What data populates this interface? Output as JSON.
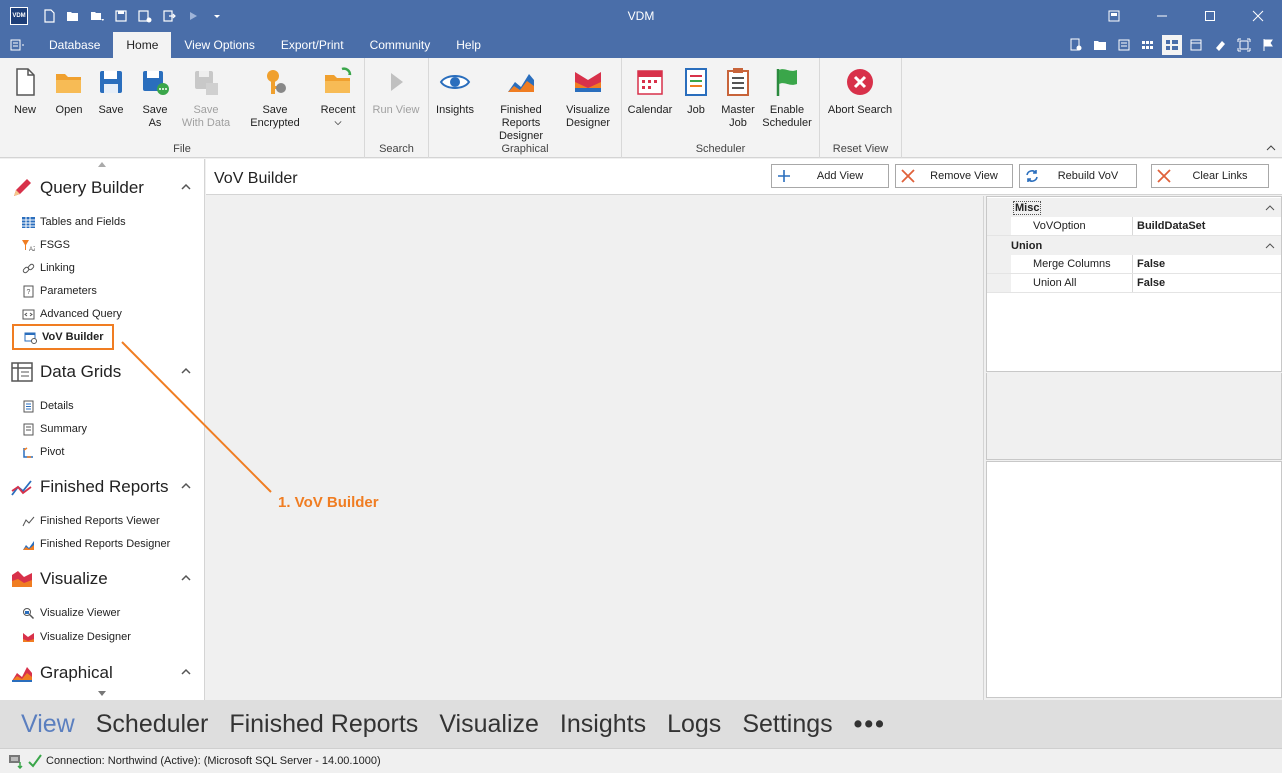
{
  "window": {
    "title": "VDM",
    "logo_text": "VDM"
  },
  "menu": {
    "tabs": [
      "Database",
      "Home",
      "View Options",
      "Export/Print",
      "Community",
      "Help"
    ],
    "active": "Home"
  },
  "ribbon": {
    "groups": [
      {
        "label": "File",
        "buttons": [
          {
            "label": "New",
            "icon": "new-file-icon"
          },
          {
            "label": "Open",
            "icon": "open-folder-icon"
          },
          {
            "label": "Save",
            "icon": "save-icon"
          },
          {
            "label": "Save As",
            "icon": "save-as-icon"
          },
          {
            "label": "Save With Data",
            "icon": "save-with-data-icon",
            "disabled": true
          },
          {
            "label": "Save Encrypted",
            "icon": "save-encrypted-icon"
          },
          {
            "label": "Recent",
            "icon": "recent-folder-icon"
          }
        ]
      },
      {
        "label": "Search",
        "buttons": [
          {
            "label": "Run View",
            "icon": "run-view-icon",
            "disabled": true
          }
        ]
      },
      {
        "label": "Graphical",
        "buttons": [
          {
            "label": "Insights",
            "icon": "insights-eye-icon"
          },
          {
            "label": "Finished Reports Designer",
            "icon": "finished-reports-designer-icon"
          },
          {
            "label": "Visualize Designer",
            "icon": "visualize-designer-icon"
          }
        ]
      },
      {
        "label": "Scheduler",
        "buttons": [
          {
            "label": "Calendar",
            "icon": "calendar-icon"
          },
          {
            "label": "Job",
            "icon": "job-icon"
          },
          {
            "label": "Master Job",
            "icon": "master-job-icon"
          },
          {
            "label": "Enable Scheduler",
            "icon": "enable-scheduler-flag-icon"
          }
        ]
      },
      {
        "label": "Reset View",
        "buttons": [
          {
            "label": "Abort Search",
            "icon": "abort-search-icon"
          }
        ]
      }
    ]
  },
  "sidebar": {
    "groups": [
      {
        "title": "Query Builder",
        "items": [
          "Tables and Fields",
          "FSGS",
          "Linking",
          "Parameters",
          "Advanced Query",
          "VoV Builder"
        ]
      },
      {
        "title": "Data Grids",
        "items": [
          "Details",
          "Summary",
          "Pivot"
        ]
      },
      {
        "title": "Finished Reports",
        "items": [
          "Finished Reports Viewer",
          "Finished Reports Designer"
        ]
      },
      {
        "title": "Visualize",
        "items": [
          "Visualize Viewer",
          "Visualize Designer"
        ]
      },
      {
        "title": "Graphical",
        "items": []
      }
    ],
    "selected": "VoV Builder"
  },
  "main": {
    "title": "VoV Builder",
    "toolbar": {
      "add_view": "Add View",
      "remove_view": "Remove View",
      "rebuild_vov": "Rebuild VoV",
      "clear_links": "Clear Links"
    }
  },
  "properties": {
    "categories": [
      {
        "name": "Misc",
        "rows": [
          {
            "name": "VoVOption",
            "value": "BuildDataSet"
          }
        ]
      },
      {
        "name": "Union",
        "rows": [
          {
            "name": "Merge Columns",
            "value": "False"
          },
          {
            "name": "Union All",
            "value": "False"
          }
        ]
      }
    ]
  },
  "annotation": {
    "label": "1. VoV Builder",
    "color": "#f07d22"
  },
  "bottom_nav": {
    "items": [
      "View",
      "Scheduler",
      "Finished Reports",
      "Visualize",
      "Insights",
      "Logs",
      "Settings"
    ],
    "active": "View",
    "more": "•••"
  },
  "status": {
    "connection": "Connection: Northwind (Active): (Microsoft SQL Server - 14.00.1000)"
  }
}
